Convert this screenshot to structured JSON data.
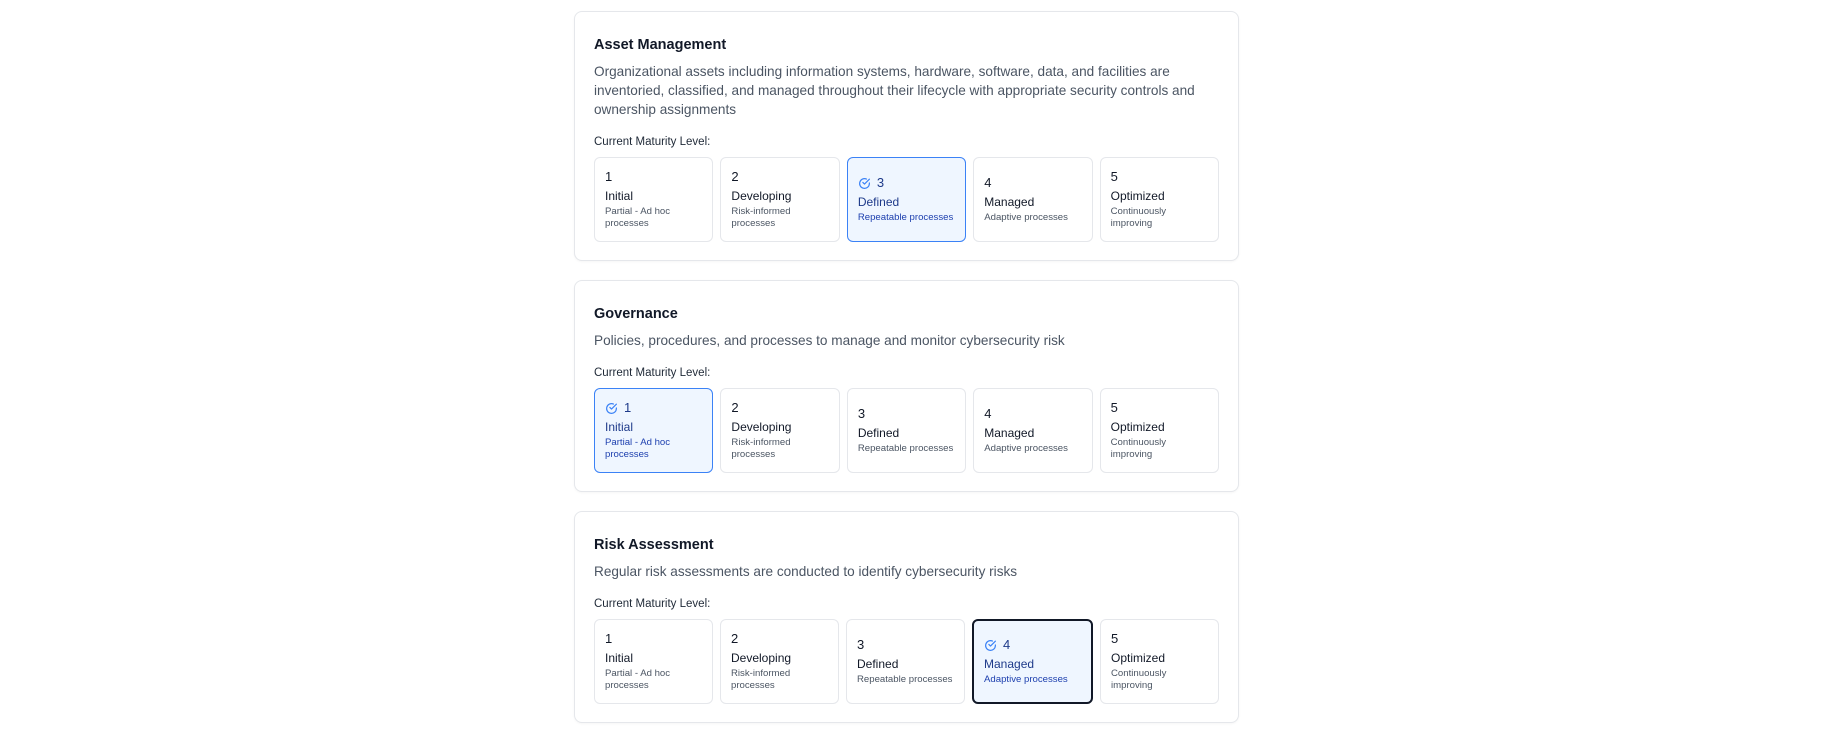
{
  "maturity_label": "Current Maturity Level:",
  "levels": [
    {
      "num": "1",
      "name": "Initial",
      "desc": "Partial - Ad hoc processes"
    },
    {
      "num": "2",
      "name": "Developing",
      "desc": "Risk-informed processes"
    },
    {
      "num": "3",
      "name": "Defined",
      "desc": "Repeatable processes"
    },
    {
      "num": "4",
      "name": "Managed",
      "desc": "Adaptive processes"
    },
    {
      "num": "5",
      "name": "Optimized",
      "desc": "Continuously improving"
    }
  ],
  "categories": [
    {
      "title": "Asset Management",
      "description": "Organizational assets including information systems, hardware, software, data, and facilities are inventoried, classified, and managed throughout their lifecycle with appropriate security controls and ownership assignments",
      "selected_level": 3,
      "focused": false
    },
    {
      "title": "Governance",
      "description": "Policies, procedures, and processes to manage and monitor cybersecurity risk",
      "selected_level": 1,
      "focused": false
    },
    {
      "title": "Risk Assessment",
      "description": "Regular risk assessments are conducted to identify cybersecurity risks",
      "selected_level": 4,
      "focused": true
    }
  ],
  "colors": {
    "selected_bg": "#eff6ff",
    "selected_border": "#3b82f6",
    "selected_text": "#1e3a8a",
    "focus_border": "#111827"
  },
  "icons": {
    "selected": "check-circle-icon"
  }
}
